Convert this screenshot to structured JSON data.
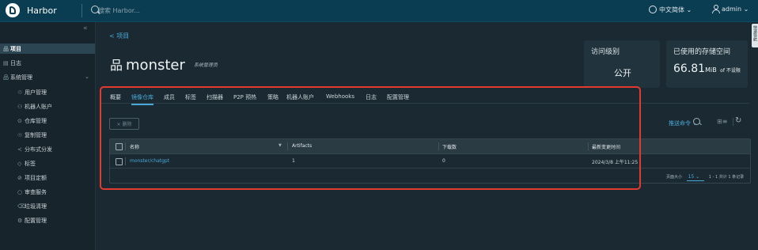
{
  "header": {
    "brand": "Harbor",
    "search_placeholder": "搜索 Harbor...",
    "language": "中文简体",
    "language_caret": "⌄",
    "user": "admin",
    "user_caret": "⌄"
  },
  "sidebar": {
    "collapse": "«",
    "items": [
      {
        "label": "项目",
        "icon": "品"
      },
      {
        "label": "日志",
        "icon": "▤"
      },
      {
        "label": "系统管理",
        "icon": "品"
      },
      {
        "label": "用户管理",
        "icon": "♲"
      },
      {
        "label": "机器人账户",
        "icon": "⚇"
      },
      {
        "label": "仓库管理",
        "icon": "⊙"
      },
      {
        "label": "复制管理",
        "icon": "☉"
      },
      {
        "label": "分布式分发",
        "icon": "≺"
      },
      {
        "label": "标签",
        "icon": "◇"
      },
      {
        "label": "项目定额",
        "icon": "⊘"
      },
      {
        "label": "审查服务",
        "icon": "○"
      },
      {
        "label": "垃圾清理",
        "icon": "⌫"
      },
      {
        "label": "配置管理",
        "icon": "⚙"
      }
    ],
    "expand_chevron": "⌄"
  },
  "breadcrumb": "< 项目",
  "project": {
    "icon": "品",
    "name": "monster",
    "role": "系统管理员"
  },
  "cards": {
    "access_label": "访问级别",
    "access_value": "公开",
    "storage_label": "已使用的存储空间",
    "storage_value": "66.81",
    "storage_unit": "MiB",
    "storage_note": "of 不设限"
  },
  "tabs": [
    "概要",
    "镜像仓库",
    "成员",
    "标签",
    "扫描器",
    "P2P 预热",
    "策略",
    "机器人账户",
    "Webhooks",
    "日志",
    "配置管理"
  ],
  "toolbar": {
    "delete_label": "× 删除",
    "push_label": "推送命令 ⌄",
    "grid_glyph": "⊞≡",
    "refresh_glyph": "↻"
  },
  "table": {
    "columns": [
      "名称",
      "Artifacts",
      "下载数",
      "最新变更时间"
    ],
    "filter_glyph": "▼",
    "rows": [
      {
        "name": "monster/chatgpt",
        "artifacts": "1",
        "pulls": "0",
        "updated": "2024/3/8 上午11:25"
      }
    ]
  },
  "pagination": {
    "page_size_label": "页面大小",
    "page_size": "15",
    "caret": "⌄",
    "summary": "1 - 1 共计 1 条记录"
  },
  "right_tab": "快速导航",
  "colors": {
    "accent": "#4aa8d8",
    "header_bg": "#0a3d52",
    "highlight": "#e23a2e"
  }
}
